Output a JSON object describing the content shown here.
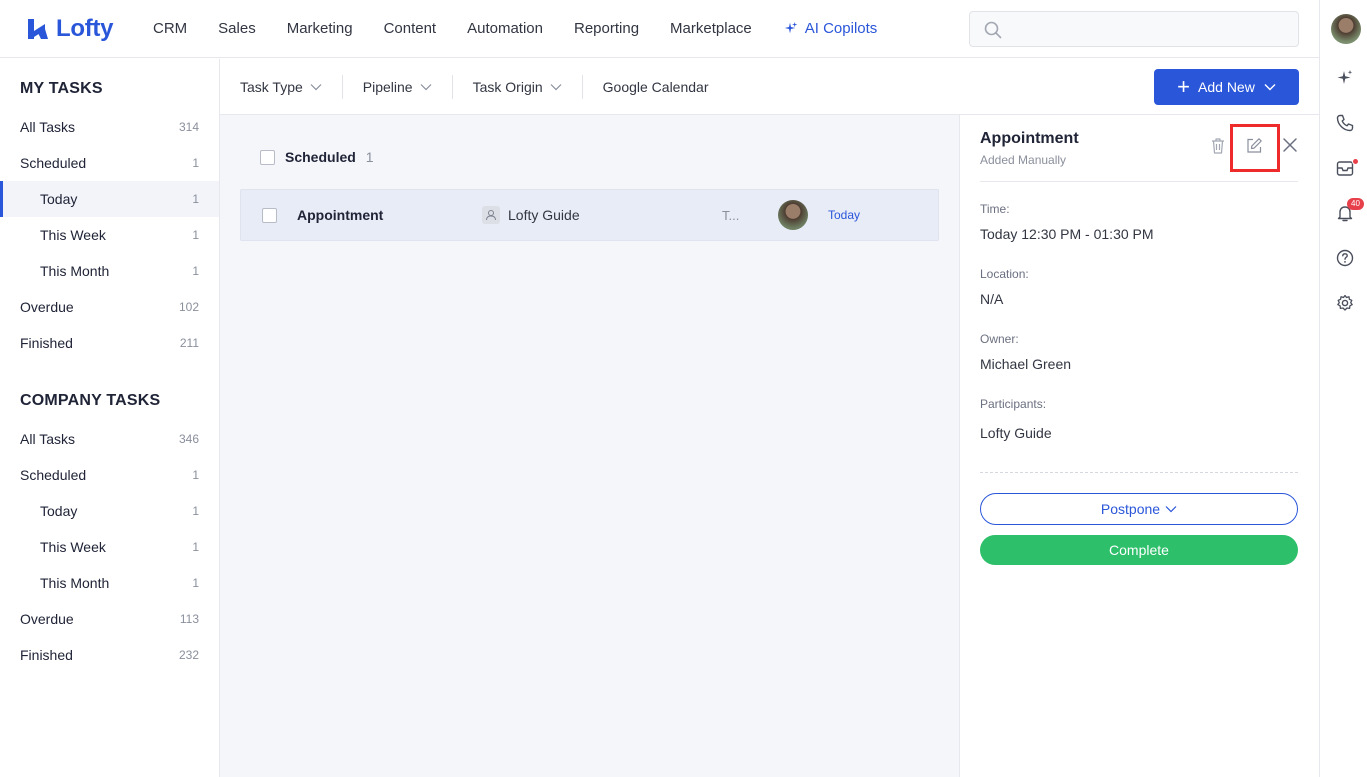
{
  "brand": {
    "name": "Lofty",
    "accent": "#2a56d9"
  },
  "nav": {
    "items": [
      "CRM",
      "Sales",
      "Marketing",
      "Content",
      "Automation",
      "Reporting",
      "Marketplace"
    ],
    "ai_label": "AI Copilots",
    "search_placeholder": ""
  },
  "rail": {
    "notification_count": "40"
  },
  "sidebar": {
    "my_tasks_title": "MY TASKS",
    "my_tasks": [
      {
        "label": "All Tasks",
        "count": "314"
      },
      {
        "label": "Scheduled",
        "count": "1"
      },
      {
        "label": "Today",
        "count": "1"
      },
      {
        "label": "This Week",
        "count": "1"
      },
      {
        "label": "This Month",
        "count": "1"
      },
      {
        "label": "Overdue",
        "count": "102"
      },
      {
        "label": "Finished",
        "count": "211"
      }
    ],
    "company_tasks_title": "COMPANY TASKS",
    "company_tasks": [
      {
        "label": "All Tasks",
        "count": "346"
      },
      {
        "label": "Scheduled",
        "count": "1"
      },
      {
        "label": "Today",
        "count": "1"
      },
      {
        "label": "This Week",
        "count": "1"
      },
      {
        "label": "This Month",
        "count": "1"
      },
      {
        "label": "Overdue",
        "count": "113"
      },
      {
        "label": "Finished",
        "count": "232"
      }
    ]
  },
  "filters": {
    "task_type": "Task Type",
    "pipeline": "Pipeline",
    "task_origin": "Task Origin",
    "google_calendar": "Google Calendar",
    "add_new": "Add New"
  },
  "list": {
    "group_title": "Scheduled",
    "group_count": "1",
    "task": {
      "name": "Appointment",
      "contact": "Lofty Guide",
      "truncated": "T...",
      "date": "Today"
    }
  },
  "detail": {
    "title": "Appointment",
    "subtitle": "Added Manually",
    "time_label": "Time:",
    "time_value": "Today 12:30 PM - 01:30 PM",
    "location_label": "Location:",
    "location_value": "N/A",
    "owner_label": "Owner:",
    "owner_value": "Michael Green",
    "participants_label": "Participants:",
    "participants_value": "Lofty Guide",
    "postpone_label": "Postpone",
    "complete_label": "Complete"
  }
}
